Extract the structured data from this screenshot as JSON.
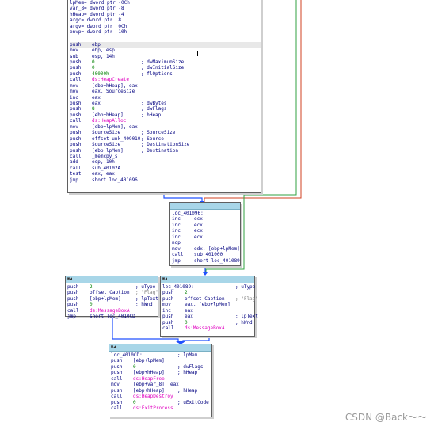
{
  "colors": {
    "title_bar": "#a8d6e8",
    "api": "#e000c0",
    "number": "#008000",
    "text": "#000080",
    "edge_blue": "#2050ff",
    "edge_red": "#d04020",
    "edge_green": "#30a040"
  },
  "node_main": {
    "vars": [
      "lpMem= dword ptr -0Ch",
      "var_8= dword ptr -8",
      "hHeap= dword ptr -4",
      "argc= dword ptr  8",
      "argv= dword ptr  0Ch",
      "envp= dword ptr  10h"
    ],
    "instructions": [
      {
        "m": "push",
        "o": "ebp",
        "c": ""
      },
      {
        "m": "mov",
        "o": "ebp, esp",
        "c": ""
      },
      {
        "m": "sub",
        "o": "esp, 14h",
        "c": ""
      },
      {
        "m": "push",
        "o": "0",
        "c": "; dwMaximumSize"
      },
      {
        "m": "push",
        "o": "0",
        "c": "; dwInitialSize"
      },
      {
        "m": "push",
        "o": "40000h",
        "c": "; flOptions"
      },
      {
        "m": "call",
        "o": "ds:HeapCreate",
        "c": ""
      },
      {
        "m": "mov",
        "o": "[ebp+hHeap], eax",
        "c": ""
      },
      {
        "m": "mov",
        "o": "eax, SourceSize",
        "c": ""
      },
      {
        "m": "inc",
        "o": "eax",
        "c": ""
      },
      {
        "m": "push",
        "o": "eax",
        "c": "; dwBytes"
      },
      {
        "m": "push",
        "o": "8",
        "c": "; dwFlags"
      },
      {
        "m": "push",
        "o": "[ebp+hHeap]",
        "c": "; hHeap"
      },
      {
        "m": "call",
        "o": "ds:HeapAlloc",
        "c": ""
      },
      {
        "m": "mov",
        "o": "[ebp+lpMem], eax",
        "c": ""
      },
      {
        "m": "push",
        "o": "SourceSize",
        "c": "; SourceSize"
      },
      {
        "m": "push",
        "o": "offset unk_409010",
        "c": "; Source"
      },
      {
        "m": "push",
        "o": "SourceSize",
        "c": "; DestinationSize"
      },
      {
        "m": "push",
        "o": "[ebp+lpMem]",
        "c": "; Destination"
      },
      {
        "m": "call",
        "o": "_memcpy_s",
        "c": ""
      },
      {
        "m": "add",
        "o": "esp, 10h",
        "c": ""
      },
      {
        "m": "call",
        "o": "sub_40102A",
        "c": ""
      },
      {
        "m": "test",
        "o": "eax, eax",
        "c": ""
      },
      {
        "m": "jmp",
        "o": "short loc_401096",
        "c": ""
      }
    ]
  },
  "node_loc_401096": {
    "lines": [
      {
        "m": "loc_401096:",
        "o": "",
        "c": ""
      },
      {
        "m": "inc",
        "o": "ecx",
        "c": ""
      },
      {
        "m": "inc",
        "o": "ecx",
        "c": ""
      },
      {
        "m": "inc",
        "o": "ecx",
        "c": ""
      },
      {
        "m": "inc",
        "o": "ecx",
        "c": ""
      },
      {
        "m": "nop",
        "o": "",
        "c": ""
      },
      {
        "m": "mov",
        "o": "edx, [ebp+lpMem]",
        "c": ""
      },
      {
        "m": "call",
        "o": "sub_401000",
        "c": ""
      },
      {
        "m": "jmp",
        "o": "short loc_401089",
        "c": ""
      }
    ]
  },
  "node_flag_left": {
    "lines": [
      {
        "m": "push",
        "o": "2",
        "c": "; uType"
      },
      {
        "m": "push",
        "o": "offset Caption",
        "c": "; \"Flag\""
      },
      {
        "m": "push",
        "o": "[ebp+lpMem]",
        "c": "; lpText"
      },
      {
        "m": "push",
        "o": "0",
        "c": "; hWnd"
      },
      {
        "m": "call",
        "o": "ds:MessageBoxA",
        "c": ""
      },
      {
        "m": "jmp",
        "o": "short loc_4010CD",
        "c": ""
      }
    ]
  },
  "node_loc_401089": {
    "lines": [
      {
        "m": "loc_401089:",
        "o": "",
        "c": "; uType"
      },
      {
        "m": "push",
        "o": "2",
        "c": ""
      },
      {
        "m": "push",
        "o": "offset Caption",
        "c": "; \"Flag\""
      },
      {
        "m": "mov",
        "o": "eax, [ebp+lpMem]",
        "c": ""
      },
      {
        "m": "inc",
        "o": "eax",
        "c": ""
      },
      {
        "m": "push",
        "o": "eax",
        "c": "; lpText"
      },
      {
        "m": "push",
        "o": "0",
        "c": "; hWnd"
      },
      {
        "m": "call",
        "o": "ds:MessageBoxA",
        "c": ""
      }
    ]
  },
  "node_loc_4010CD": {
    "lines": [
      {
        "m": "loc_4010CD:",
        "o": "",
        "c": "; lpMem"
      },
      {
        "m": "push",
        "o": "[ebp+lpMem]",
        "c": ""
      },
      {
        "m": "push",
        "o": "0",
        "c": "; dwFlags"
      },
      {
        "m": "push",
        "o": "[ebp+hHeap]",
        "c": "; hHeap"
      },
      {
        "m": "call",
        "o": "ds:HeapFree",
        "c": ""
      },
      {
        "m": "mov",
        "o": "[ebp+var_8], eax",
        "c": ""
      },
      {
        "m": "push",
        "o": "[ebp+hHeap]",
        "c": "; hHeap"
      },
      {
        "m": "call",
        "o": "ds:HeapDestroy",
        "c": ""
      },
      {
        "m": "push",
        "o": "0",
        "c": "; uExitCode"
      },
      {
        "m": "call",
        "o": "ds:ExitProcess",
        "c": ""
      }
    ]
  },
  "watermark": "CSDN @Back～～"
}
